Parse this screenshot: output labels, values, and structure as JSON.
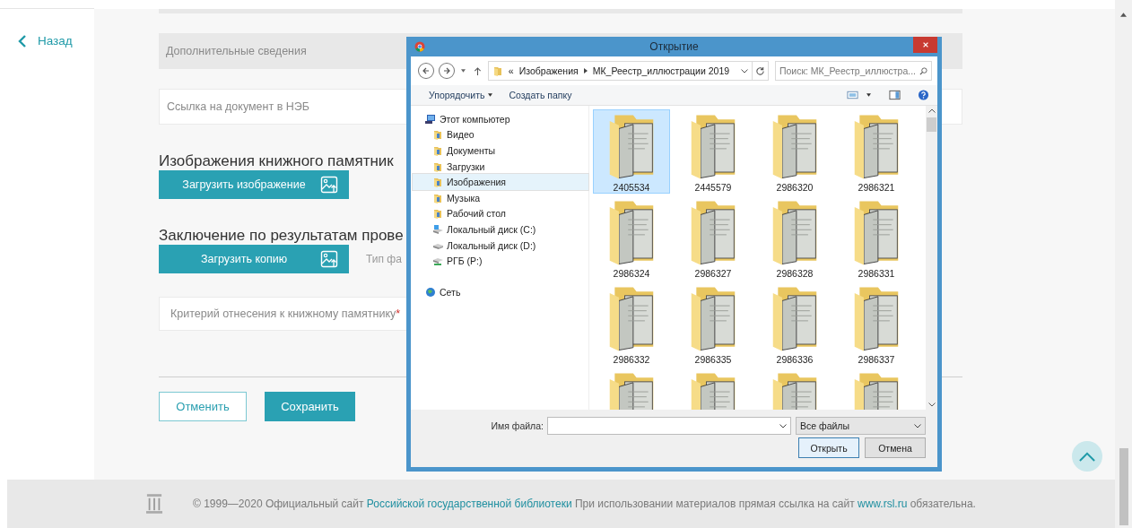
{
  "back_link": {
    "label": "Назад"
  },
  "form": {
    "fields": [
      {
        "kind": "gray",
        "placeholder": "Дополнительные сведения"
      },
      {
        "kind": "input",
        "placeholder": "Ссылка на документ в НЭБ"
      }
    ],
    "sections": [
      {
        "heading": "Изображения книжного памятник",
        "upload_button": "Загрузить изображение"
      },
      {
        "heading": "Заключение по результатам прове",
        "upload_button": "Загрузить копию",
        "hint": "Тип фа"
      }
    ],
    "criterion_select": {
      "placeholder": "Критерий отнесения к книжному памятнику",
      "required_mark": "*"
    },
    "buttons": [
      {
        "label": "Отменить",
        "kind": "secondary"
      },
      {
        "label": "Сохранить",
        "kind": "primary"
      }
    ]
  },
  "dialog": {
    "title": "Открытие",
    "address": {
      "overflow_mark": "«",
      "path": [
        "Изображения",
        "МК_Реестр_иллюстрации 2019"
      ]
    },
    "search": {
      "placeholder": "Поиск: МК_Реестр_иллюстра..."
    },
    "toolbar": [
      {
        "label": "Упорядочить",
        "kind": "menu"
      },
      {
        "label": "Создать папку",
        "kind": "command"
      }
    ],
    "tree": [
      {
        "label": "Этот компьютер",
        "kind": "computer",
        "selected": false,
        "children": [
          {
            "label": "Видео",
            "kind": "folder",
            "selected": false
          },
          {
            "label": "Документы",
            "kind": "folder",
            "selected": false
          },
          {
            "label": "Загрузки",
            "kind": "folder",
            "selected": false
          },
          {
            "label": "Изображения",
            "kind": "folder",
            "selected": true
          },
          {
            "label": "Музыка",
            "kind": "folder",
            "selected": false
          },
          {
            "label": "Рабочий стол",
            "kind": "folder",
            "selected": false
          },
          {
            "label": "Локальный диск (C:)",
            "kind": "system_drive",
            "selected": false
          },
          {
            "label": "Локальный диск (D:)",
            "kind": "drive",
            "selected": false
          },
          {
            "label": "РГБ (P:)",
            "kind": "network_drive",
            "selected": false
          }
        ]
      },
      {
        "label": "Сеть",
        "kind": "network",
        "selected": false
      }
    ],
    "files": [
      {
        "name": "2405534",
        "selected": true
      },
      {
        "name": "2445579",
        "selected": false
      },
      {
        "name": "2986320",
        "selected": false
      },
      {
        "name": "2986321",
        "selected": false
      },
      {
        "name": "2986324",
        "selected": false
      },
      {
        "name": "2986327",
        "selected": false
      },
      {
        "name": "2986328",
        "selected": false
      },
      {
        "name": "2986331",
        "selected": false
      },
      {
        "name": "2986332",
        "selected": false
      },
      {
        "name": "2986335",
        "selected": false
      },
      {
        "name": "2986336",
        "selected": false
      },
      {
        "name": "2986337",
        "selected": false
      },
      {
        "selected": false
      },
      {
        "selected": false
      },
      {
        "selected": false
      },
      {
        "selected": false
      }
    ],
    "filename_label": "Имя файла:",
    "file_type": "Все файлы",
    "buttons": [
      {
        "label": "Открыть",
        "kind": "default"
      },
      {
        "label": "Отмена",
        "kind": "normal"
      }
    ]
  },
  "footer": {
    "copyright": "© 1999—2020 Официальный сайт ",
    "library_link": "Российской государственной библиотеки",
    "middle": " При использовании материалов прямая ссылка на сайт ",
    "site_link": "www.rsl.ru",
    "end": " обязательна."
  }
}
